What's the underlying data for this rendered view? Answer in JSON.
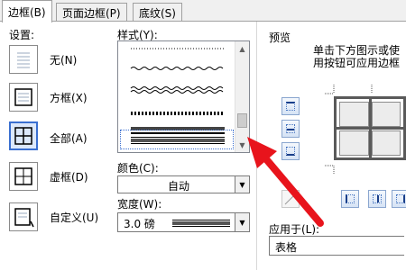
{
  "tabs": [
    {
      "label": "边框(B)"
    },
    {
      "label": "页面边框(P)"
    },
    {
      "label": "底纹(S)"
    }
  ],
  "settings": {
    "heading": "设置:",
    "options": [
      {
        "label": "无(N)",
        "icon": "border-none-icon"
      },
      {
        "label": "方框(X)",
        "icon": "border-box-icon"
      },
      {
        "label": "全部(A)",
        "icon": "border-all-icon",
        "selected": true
      },
      {
        "label": "虚框(D)",
        "icon": "border-grid-icon"
      },
      {
        "label": "自定义(U)",
        "icon": "border-custom-icon"
      }
    ]
  },
  "style": {
    "heading": "样式(Y):",
    "line_styles": [
      "dotted",
      "wavy",
      "double-wavy",
      "hatched",
      "thick-thin",
      "thin-thick-double"
    ]
  },
  "color": {
    "label": "颜色(C):",
    "value": "自动"
  },
  "width": {
    "label": "宽度(W):",
    "value": "3.0 磅"
  },
  "preview": {
    "heading": "预览",
    "hint": "单击下方图示或使用按钮可应用边框"
  },
  "apply_to": {
    "label": "应用于(L):",
    "value": "表格"
  },
  "colors": {
    "accent": "#3a6fd0",
    "arrow": "#e8141c"
  }
}
